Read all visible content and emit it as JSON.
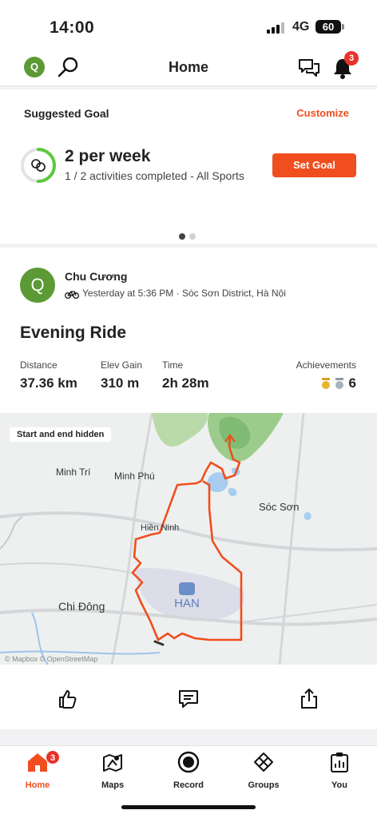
{
  "status": {
    "time": "14:00",
    "network": "4G",
    "battery": "60",
    "battery_level": 0.6
  },
  "header": {
    "title": "Home",
    "avatar_letter": "Q",
    "notif_count": "3"
  },
  "goal": {
    "heading": "Suggested Goal",
    "customize": "Customize",
    "title": "2 per week",
    "subtitle": "1 / 2 activities completed - All Sports",
    "progress": 0.5,
    "set_goal": "Set Goal"
  },
  "activity": {
    "athlete_letter": "Q",
    "athlete": "Chu Cương",
    "meta": "Yesterday at 5:36 PM · Sóc Sơn District, Hà Nội",
    "title": "Evening Ride",
    "stats": [
      {
        "label": "Distance",
        "value": "37.36 km"
      },
      {
        "label": "Elev Gain",
        "value": "310 m"
      },
      {
        "label": "Time",
        "value": "2h 28m"
      }
    ],
    "achievements_label": "Achievements",
    "achievements_count": "6",
    "map": {
      "hidden_note": "Start and end hidden",
      "labels": {
        "minh_tri": "Minh Trí",
        "minh_phu": "Minh Phú",
        "soc_son": "Sóc Sơn",
        "hien_ninh": "Hiền Ninh",
        "chi_dong": "Chi Đông",
        "airport": "HAN"
      },
      "copyright": "© Mapbox © OpenStreetMap"
    }
  },
  "tabs": [
    {
      "label": "Home",
      "badge": "3"
    },
    {
      "label": "Maps"
    },
    {
      "label": "Record"
    },
    {
      "label": "Groups"
    },
    {
      "label": "You"
    }
  ],
  "colors": {
    "accent": "#f04e1e",
    "avatar": "#5b9a34",
    "badge": "#e8322b",
    "route": "#f04e1e"
  }
}
